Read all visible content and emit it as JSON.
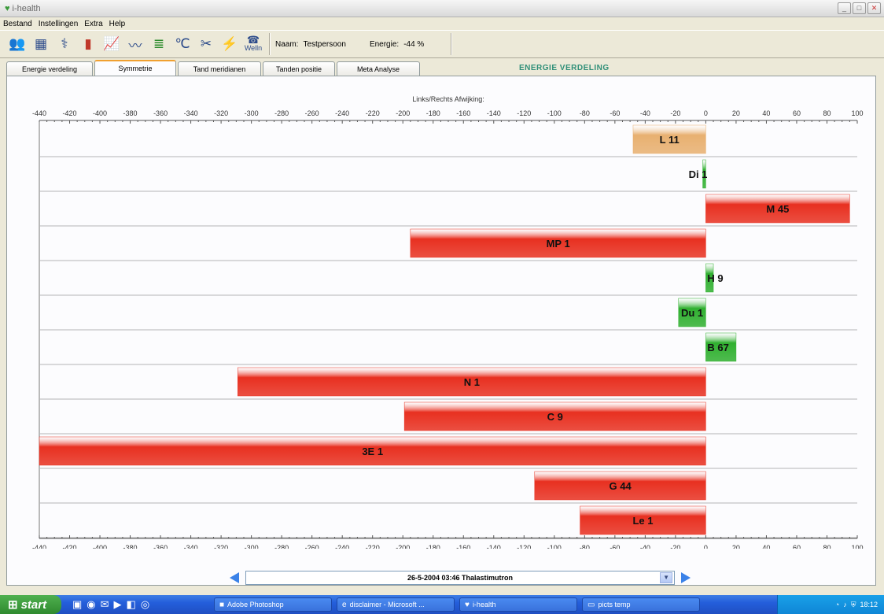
{
  "window": {
    "title": "i-health",
    "app_icon": "health-app-icon"
  },
  "menu": [
    "Bestand",
    "Instellingen",
    "Extra",
    "Help"
  ],
  "toolbar": {
    "buttons": [
      {
        "icon": "people-icon",
        "glyph": "👥"
      },
      {
        "icon": "grid-icon",
        "glyph": "▦"
      },
      {
        "icon": "tooth-icon",
        "glyph": "⚕"
      },
      {
        "icon": "bar-chart-icon",
        "glyph": "▮"
      },
      {
        "icon": "line-chart-icon",
        "glyph": "📈"
      },
      {
        "icon": "wave-chart-icon",
        "glyph": "〰"
      },
      {
        "icon": "equalizer-icon",
        "glyph": "≣"
      },
      {
        "icon": "temperature-icon",
        "glyph": "℃"
      },
      {
        "icon": "scissors-icon",
        "glyph": "✂"
      },
      {
        "icon": "signal-icon",
        "glyph": "⚡"
      },
      {
        "icon": "welln-icon",
        "glyph": "☎",
        "label": "Welln"
      }
    ],
    "name_label": "Naam:",
    "name_value": "Testpersoon",
    "energy_label": "Energie:",
    "energy_value": "-44 %"
  },
  "tabs": [
    {
      "label": "Energie verdeling",
      "active": false
    },
    {
      "label": "Symmetrie",
      "active": true
    },
    {
      "label": "Tand meridianen",
      "active": false
    },
    {
      "label": "Tanden positie",
      "active": false
    },
    {
      "label": "Meta Analyse",
      "active": false
    }
  ],
  "view_title": "ENERGIE VERDELING",
  "chart_data": {
    "type": "bar",
    "orientation": "horizontal",
    "title": "Links/Rechts Afwijking:",
    "xlim": [
      -440,
      100
    ],
    "xticks": [
      -440,
      -420,
      -400,
      -380,
      -360,
      -340,
      -320,
      -300,
      -280,
      -260,
      -240,
      -220,
      -200,
      -180,
      -160,
      -140,
      -120,
      -100,
      -80,
      -60,
      -40,
      -20,
      0,
      20,
      40,
      60,
      80,
      100
    ],
    "grid": false,
    "bars": [
      {
        "label": "L 11",
        "value": -48,
        "color": "#e8b070"
      },
      {
        "label": "Di 1",
        "value": -2,
        "color": "#30b030"
      },
      {
        "label": "M 45",
        "value": 95,
        "color": "#e83020"
      },
      {
        "label": "MP 1",
        "value": -195,
        "color": "#e83020"
      },
      {
        "label": "H 9",
        "value": 5,
        "color": "#30b030"
      },
      {
        "label": "Du 1",
        "value": -18,
        "color": "#30b030"
      },
      {
        "label": "B 67",
        "value": 20,
        "color": "#30b030"
      },
      {
        "label": "N 1",
        "value": -309,
        "color": "#e83020"
      },
      {
        "label": "C 9",
        "value": -199,
        "color": "#e83020"
      },
      {
        "label": "3E 1",
        "value": -440,
        "color": "#e83020"
      },
      {
        "label": "G 44",
        "value": -113,
        "color": "#e83020"
      },
      {
        "label": "Le 1",
        "value": -83,
        "color": "#e83020"
      }
    ]
  },
  "navigator": {
    "selected": "26-5-2004 03:46  Thalastimutron",
    "prev_icon": "arrow-left-icon",
    "next_icon": "arrow-right-icon",
    "dropdown_icon": "chevron-down-icon"
  },
  "taskbar": {
    "start_label": "start",
    "tasks": [
      {
        "label": "Adobe Photoshop",
        "icon": "photoshop-icon",
        "glyph": "■"
      },
      {
        "label": "disclaimer - Microsoft ...",
        "icon": "ie-icon",
        "glyph": "e"
      },
      {
        "label": "i-health",
        "icon": "health-app-icon",
        "glyph": "♥"
      },
      {
        "label": "picts temp",
        "icon": "folder-icon",
        "glyph": "▭"
      }
    ],
    "clock": "18:12"
  }
}
